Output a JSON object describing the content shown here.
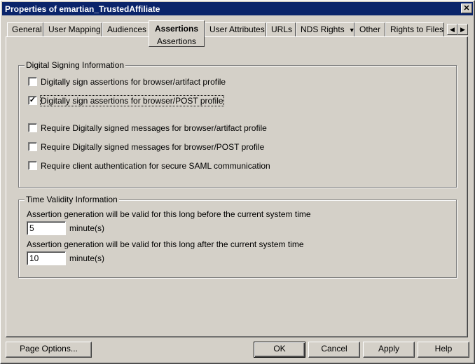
{
  "window": {
    "title": "Properties of emartian_TrustedAffiliate",
    "close_glyph": "✕"
  },
  "tabs": [
    {
      "label": "General"
    },
    {
      "label": "User Mapping"
    },
    {
      "label": "Audiences"
    },
    {
      "label": "Assertions",
      "sublabel": "Assertions",
      "active": true
    },
    {
      "label": "User Attributes"
    },
    {
      "label": "URLs"
    },
    {
      "label": "NDS Rights",
      "has_dropdown": true
    },
    {
      "label": "Other"
    },
    {
      "label": "Rights to Files"
    }
  ],
  "tab_scroll": {
    "left_glyph": "◀",
    "right_glyph": "▶"
  },
  "digital_signing": {
    "legend": "Digital Signing Information",
    "options": [
      {
        "label": "Digitally sign assertions for browser/artifact profile",
        "checked": false
      },
      {
        "label": "Digitally sign assertions for browser/POST profile",
        "checked": true
      },
      {
        "label": "Require Digitally signed messages for browser/artifact profile",
        "checked": false
      },
      {
        "label": "Require Digitally signed messages for browser/POST profile",
        "checked": false
      },
      {
        "label": "Require client authentication for secure SAML communication",
        "checked": false
      }
    ]
  },
  "time_validity": {
    "legend": "Time Validity Information",
    "before_label": "Assertion generation will be valid for this long before the current system time",
    "before_value": "5",
    "after_label": "Assertion generation will be valid for this long after the current system time",
    "after_value": "10",
    "unit": "minute(s)"
  },
  "buttons": {
    "page_options": "Page Options...",
    "ok": "OK",
    "cancel": "Cancel",
    "apply": "Apply",
    "help": "Help"
  }
}
